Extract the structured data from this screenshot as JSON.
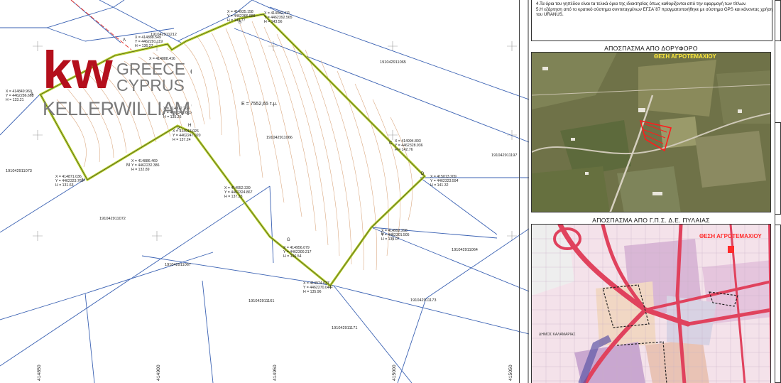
{
  "notes": {
    "line4": "4.Τα όρια του γηπέδου είναι τα τελικά όρια της ιδιοκτησίας όπως καθορίζονται από την  εφαρμογή των τίτλων.",
    "line5a": "5.Η εξάρτηση από το κρατικό σύστημα συντεταγμένων ΕΓΣΑ΄87 πραγματοποιήθηκε με σύστημα  GPS και κάνοντας χρήση",
    "line5b": "   του URANUS."
  },
  "satellite": {
    "title": "ΑΠΟΣΠΑΣΜΑ ΑΠΟ ΔΟΡΥΦΟΡΟ",
    "marker": "ΘΕΣΗ  ΑΓΡΟΤΕΜΑΧΙΟΥ"
  },
  "gps": {
    "title": "ΑΠΟΣΠΑΣΜΑ ΑΠΟ  Γ.Π.Σ.  Δ.Ε.  ΠΥΛΑΙΑΣ",
    "marker": "ΘΕΣΗ  ΑΓΡΟΤΕΜΑΧΙΟΥ",
    "municipality": "ΔΗΜΟΣ ΚΑΛΑΜΑΡΙΑΣ"
  },
  "logo": {
    "kw": "kw",
    "line1": "GREECE &",
    "line2": "CYPRUS",
    "brand": "KELLERWILLIAMS"
  },
  "plan": {
    "area": "Ε = 7552,65 τ.μ.",
    "kaek": {
      "p1212": "191042911212",
      "p1065": "191042911065",
      "p1066": "191042911066",
      "p1197": "191042911197",
      "p1073": "191042911073",
      "p1072": "191042911072",
      "p1064": "191042911064",
      "p1067": "191042911067",
      "p1161": "191042911161",
      "p1173": "191042911173",
      "p1171": "191042911171"
    },
    "x_ticks": [
      "414850",
      "414900",
      "414950",
      "415000",
      "415050"
    ],
    "vertices": {
      "A": "A",
      "B": "B",
      "C": "C",
      "D": "D",
      "E": "E",
      "F": "F",
      "G": "G",
      "H": "H",
      "K": "K",
      "L": "Λ",
      "M": "M",
      "N": "N"
    }
  }
}
